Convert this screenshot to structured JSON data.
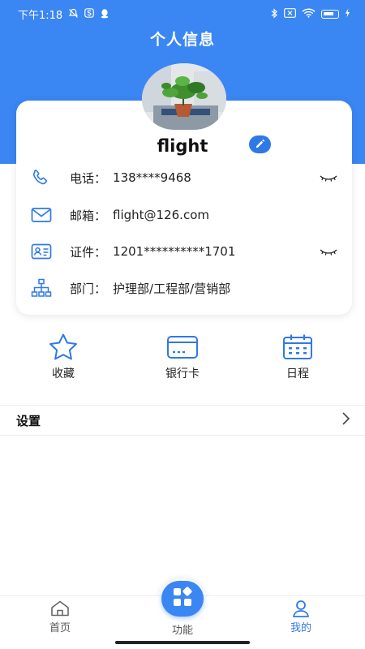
{
  "status_bar": {
    "time": "下午1:18",
    "battery_label": "battery-icon"
  },
  "header": {
    "title": "个人信息"
  },
  "profile": {
    "name": "flight",
    "rows": [
      {
        "icon": "phone-icon",
        "label": "电话",
        "sep": "：",
        "value": "138****9468",
        "masked": true
      },
      {
        "icon": "mail-icon",
        "label": "邮箱",
        "sep": "：",
        "value": "flight@126.com",
        "masked": false
      },
      {
        "icon": "id-card-icon",
        "label": "证件",
        "sep": "：",
        "value": "1201**********1701",
        "masked": true
      },
      {
        "icon": "org-chart-icon",
        "label": "部门",
        "sep": "：",
        "value": "护理部/工程部/营销部",
        "masked": false
      }
    ]
  },
  "quick_actions": [
    {
      "icon": "star-icon",
      "label": "收藏"
    },
    {
      "icon": "bank-card-icon",
      "label": "银行卡"
    },
    {
      "icon": "calendar-icon",
      "label": "日程"
    }
  ],
  "settings": {
    "label": "设置"
  },
  "tabbar": {
    "items": [
      {
        "icon": "home-icon",
        "label": "首页",
        "active": false
      },
      {
        "icon": "apps-icon",
        "label": "功能",
        "active": false
      },
      {
        "icon": "user-icon",
        "label": "我的",
        "active": true
      }
    ]
  },
  "colors": {
    "brand": "#3a86f3",
    "icon_blue": "#2f79e6"
  }
}
